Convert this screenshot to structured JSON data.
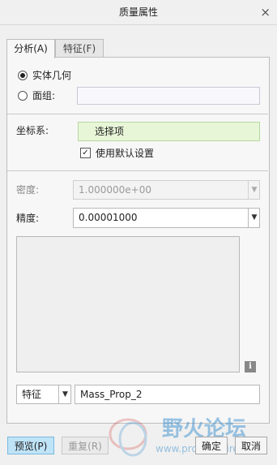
{
  "window": {
    "title": "质量属性",
    "close_glyph": "×"
  },
  "tabs": [
    {
      "label": "分析(A)",
      "active": true
    },
    {
      "label": "特征(F)",
      "active": false
    }
  ],
  "geometry": {
    "options": [
      {
        "label": "实体几何",
        "selected": true
      },
      {
        "label": "面组:",
        "selected": false
      }
    ],
    "surface_value": ""
  },
  "coordinate_system": {
    "label": "坐标系:",
    "value": "选择项",
    "use_default_label": "使用默认设置",
    "use_default_checked": true,
    "check_glyph": "✓"
  },
  "density": {
    "label": "密度:",
    "value": "1.000000e+00",
    "arrow": "▼"
  },
  "precision": {
    "label": "精度:",
    "value": "0.00001000",
    "arrow": "▼"
  },
  "info_glyph": "i",
  "feature": {
    "type_value": "特征",
    "arrow": "▼",
    "name_value": "Mass_Prop_2"
  },
  "buttons": {
    "preview": "预览(P)",
    "repeat": "重复(R)",
    "ok": "确定",
    "cancel": "取消"
  },
  "watermark": {
    "text_cn": "野火论坛",
    "text_url": "www.proewildfire.cn"
  },
  "colors": {
    "selector_green": "#e8f6d8",
    "primary_blue": "#bfe3f7",
    "watermark_blue": "#3a8fd0"
  }
}
